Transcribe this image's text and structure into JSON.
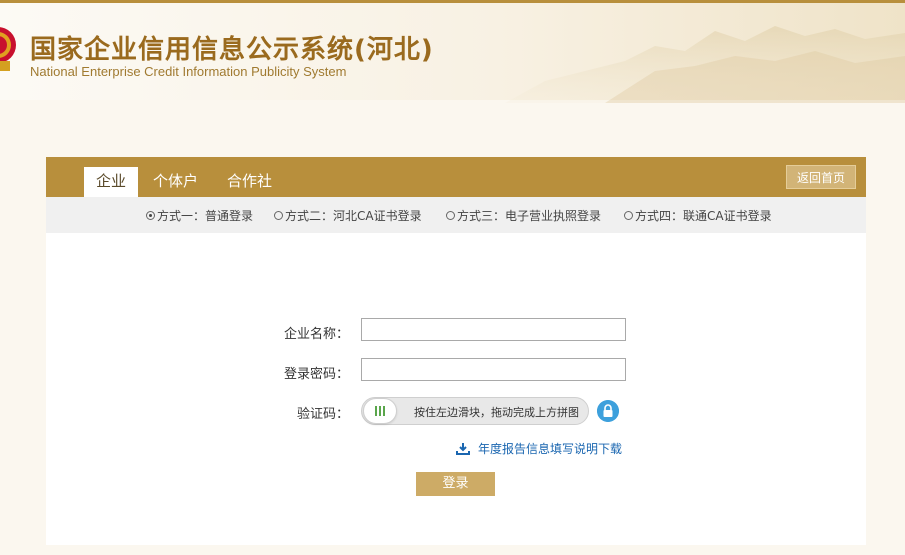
{
  "header": {
    "title_cn": "国家企业信用信息公示系统(河北)",
    "title_en": "National Enterprise Credit Information Publicity System"
  },
  "tabs": [
    {
      "label": "企业",
      "active": true
    },
    {
      "label": "个体户",
      "active": false
    },
    {
      "label": "合作社",
      "active": false
    }
  ],
  "home_button": "返回首页",
  "methods": [
    {
      "label": "方式一：普通登录",
      "selected": true
    },
    {
      "label": "方式二：河北CA证书登录",
      "selected": false
    },
    {
      "label": "方式三：电子营业执照登录",
      "selected": false
    },
    {
      "label": "方式四：联通CA证书登录",
      "selected": false
    }
  ],
  "form": {
    "company_label": "企业名称：",
    "company_value": "",
    "password_label": "登录密码：",
    "password_value": "",
    "captcha_label": "验证码：",
    "slider_text": "按住左边滑块，拖动完成上方拼图",
    "download_text": "年度报告信息填写说明下载",
    "login_button": "登录"
  },
  "colors": {
    "accent": "#b88f3c",
    "title": "#9a6a1e",
    "button": "#cdab66",
    "link": "#1a66b0",
    "lock": "#3da0dc"
  },
  "icons": [
    "national-emblem-icon",
    "grip-icon",
    "lock-icon",
    "download-icon"
  ]
}
